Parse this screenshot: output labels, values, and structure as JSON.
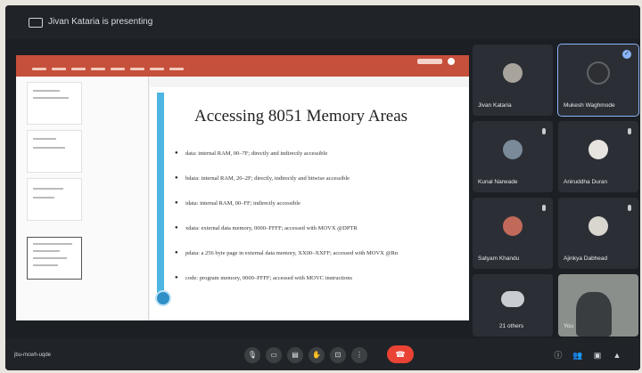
{
  "header": {
    "presenter_text": "Jivan Kataria is presenting"
  },
  "slide": {
    "title": "Accessing 8051 Memory Areas",
    "bullets": [
      "data: internal RAM, 00–7F; directly and indirectly accessible",
      "bdata: internal RAM, 20–2F; directly, indirectly and bitwise accessible",
      "idata: internal RAM, 00–FF; indirectly accessible",
      "xdata: external data memory, 0000–FFFF; accessed with MOVX @DPTR",
      "pdata: a 256 byte page in external data memory, XX00–XXFF; accessed with MOVX @Rn",
      "code: program memory, 0000–FFFF; accessed with MOVC instructions"
    ]
  },
  "participants": [
    {
      "name": "Jivan Kataria"
    },
    {
      "name": "Mukesh Waghmode"
    },
    {
      "name": "Kunal Narwade"
    },
    {
      "name": "Aniruddha Duran"
    },
    {
      "name": "Satyam Khandu"
    },
    {
      "name": "Ajinkya Dabhead"
    },
    {
      "name": "21 others"
    },
    {
      "name": "You"
    }
  ],
  "bottom": {
    "meeting_code": "jbu-mcwh-uqde"
  }
}
